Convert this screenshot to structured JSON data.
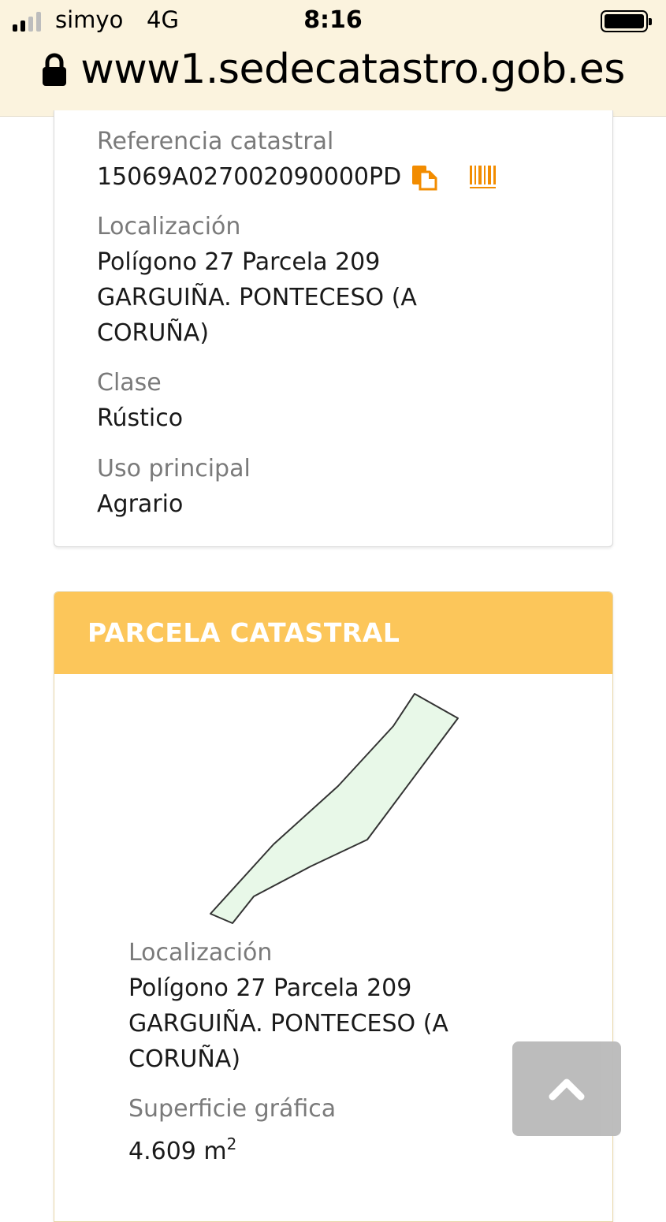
{
  "status_bar": {
    "carrier": "simyo",
    "network": "4G",
    "time": "8:16",
    "url": "www1.sedecatastro.gob.es"
  },
  "property": {
    "ref_label": "Referencia catastral",
    "ref_value": "15069A027002090000PD",
    "loc_label": "Localización",
    "loc_line1": "Polígono 27 Parcela 209",
    "loc_line2": "GARGUIÑA. PONTECESO (A",
    "loc_line3": "CORUÑA)",
    "class_label": "Clase",
    "class_value": "Rústico",
    "use_label": "Uso principal",
    "use_value": "Agrario"
  },
  "parcel": {
    "header": "PARCELA CATASTRAL",
    "loc_label": "Localización",
    "loc_line1": "Polígono 27 Parcela 209",
    "loc_line2": "GARGUIÑA. PONTECESO (A",
    "loc_line3": "CORUÑA)",
    "surface_label": "Superficie gráfica",
    "surface_value": "4.609 m",
    "surface_unit_exp": "2"
  },
  "colors": {
    "header_bg": "#fcc65a",
    "icon_orange": "#f28c00",
    "parcel_fill": "#e8f8e8"
  },
  "icons": [
    "lock-icon",
    "copy-icon",
    "barcode-icon",
    "chevron-up-icon"
  ]
}
